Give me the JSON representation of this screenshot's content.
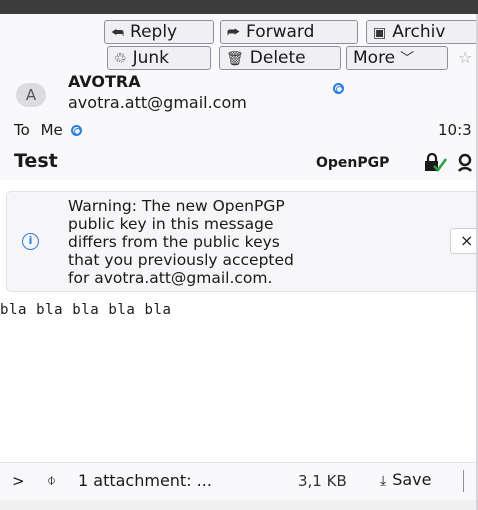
{
  "toolbar": {
    "reply": "Reply",
    "forward": "Forward",
    "archive": "Archiv",
    "junk": "Junk",
    "delete": "Delete",
    "more": "More"
  },
  "message": {
    "avatar_letter": "A",
    "from_name": "AVOTRA",
    "from_email": "avotra.att@gmail.com",
    "to_label": "To",
    "to_value": "Me",
    "time": "10:3",
    "subject": "Test",
    "security_label": "OpenPGP"
  },
  "warning": {
    "lines": [
      "Warning: The new OpenPGP",
      "public key in this message",
      "differs from the public keys",
      "that you previously accepted",
      "for avotra.att@gmail.com."
    ],
    "close": "×"
  },
  "body": {
    "text": "bla bla bla bla bla"
  },
  "attachments": {
    "toggle": ">",
    "summary": "1 attachment: ...",
    "size": "3,1 KB",
    "save": "Save"
  },
  "icons": {
    "reply": "reply-icon",
    "forward": "forward-icon",
    "archive": "archive-icon",
    "junk": "junk-icon",
    "delete": "trash-icon",
    "more": "chevron-down-icon",
    "info": "info-icon",
    "attachment": "paperclip-icon",
    "save": "download-icon"
  },
  "colors": {
    "accent": "#2a7de1",
    "verified": "#2ea043",
    "header_bg": "#f9f9fb"
  }
}
